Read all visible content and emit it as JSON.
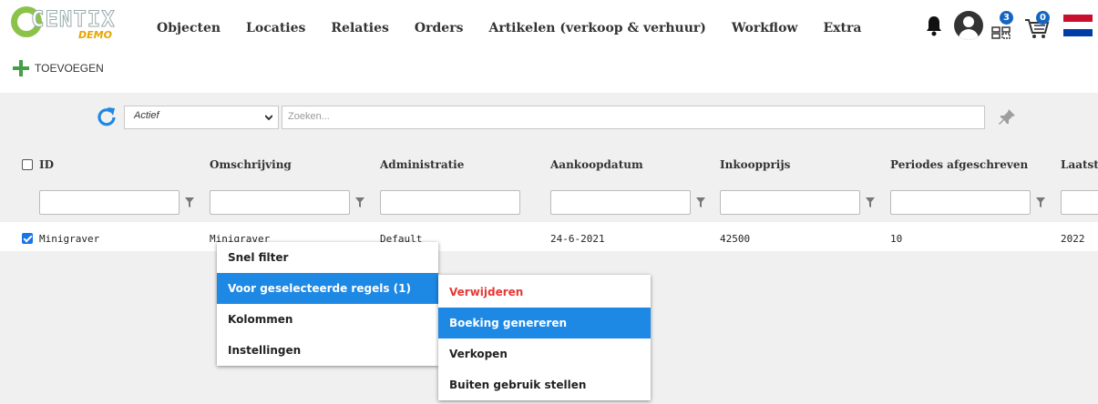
{
  "logo": {
    "brand": "CENTIX",
    "sub": "DEMO"
  },
  "nav": [
    "Objecten",
    "Locaties",
    "Relaties",
    "Orders",
    "Artikelen (verkoop & verhuur)",
    "Workflow",
    "Extra"
  ],
  "header_icons": {
    "bell": "bell-icon",
    "user": "user-avatar-icon",
    "grid": "grid-icon",
    "cart": "cart-icon",
    "flag": "dutch-flag-icon"
  },
  "badges": {
    "grid": "3",
    "cart": "0"
  },
  "colors": {
    "accent": "#1e88e5",
    "add": "#43a047",
    "danger": "#e53935",
    "badge": "#1565c0"
  },
  "toolbar": {
    "add_label": "TOEVOEGEN"
  },
  "filter": {
    "status_value": "Actief",
    "search_placeholder": "Zoeken..."
  },
  "table": {
    "headers": [
      "ID",
      "Omschrijving",
      "Administratie",
      "Aankoopdatum",
      "Inkoopprijs",
      "Periodes afgeschreven",
      "Laatst"
    ],
    "rows": [
      {
        "checked": true,
        "cells": [
          "Minigraver",
          "Minigraver",
          "Default",
          "24-6-2021",
          "42500",
          "10",
          "2022"
        ]
      }
    ]
  },
  "context_menu": {
    "items": [
      "Snel filter",
      "Voor geselecteerde regels (1)",
      "Kolommen",
      "Instellingen"
    ],
    "active_index": 1
  },
  "submenu": {
    "items": [
      "Verwijderen",
      "Boeking genereren",
      "Verkopen",
      "Buiten gebruik stellen"
    ],
    "active_index": 1,
    "danger_index": 0
  }
}
